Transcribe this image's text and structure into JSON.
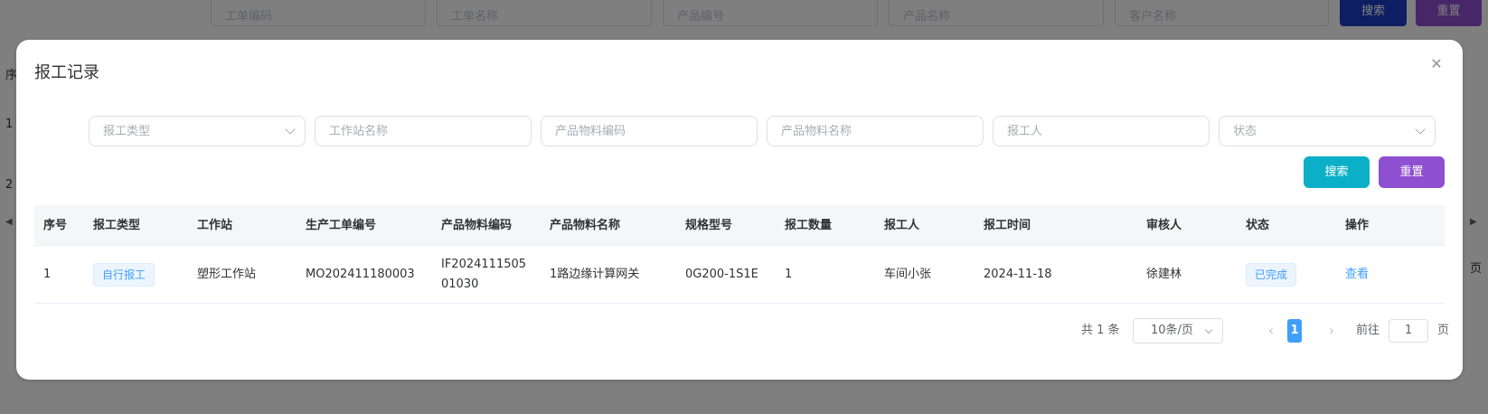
{
  "background": {
    "filters": [
      {
        "placeholder": "工单编码"
      },
      {
        "placeholder": "工单名称"
      },
      {
        "placeholder": "产品编号"
      },
      {
        "placeholder": "产品名称"
      },
      {
        "placeholder": "客户名称"
      }
    ],
    "search_label": "搜索",
    "reset_label": "重置",
    "side_labels": [
      "序",
      "1",
      "2"
    ],
    "right_label": "页"
  },
  "dialog": {
    "title": "报工记录",
    "close_icon": "close-icon",
    "filters": {
      "report_type": "报工类型",
      "station_name": "工作站名称",
      "material_code": "产品物料编码",
      "material_name": "产品物料名称",
      "reporter": "报工人",
      "status": "状态"
    },
    "search_label": "搜索",
    "reset_label": "重置",
    "table": {
      "columns": [
        "序号",
        "报工类型",
        "工作站",
        "生产工单编号",
        "产品物料编码",
        "产品物料名称",
        "规格型号",
        "报工数量",
        "报工人",
        "报工时间",
        "审核人",
        "状态",
        "操作"
      ],
      "rows": [
        {
          "index": "1",
          "report_type": "自行报工",
          "station": "塑形工作站",
          "work_order": "MO202411180003",
          "material_code": "IF202411150501030",
          "material_name": "1路边缘计算网关",
          "spec": "0G200-1S1E",
          "quantity": "1",
          "reporter": "车间小张",
          "report_time": "2024-11-18",
          "auditor": "徐建林",
          "status": "已完成",
          "action": "查看"
        }
      ]
    },
    "pagination": {
      "total": "共 1 条",
      "page_size": "10条/页",
      "current_page": "1",
      "goto_label": "前往",
      "goto_value": "1",
      "unit_label": "页"
    }
  },
  "colors": {
    "search_button": "#0bb0c8",
    "reset_button": "#8e4fd0",
    "bg_search_button": "#1b3fc4",
    "bg_reset_button": "#8e4fd0",
    "link": "#409eff"
  }
}
